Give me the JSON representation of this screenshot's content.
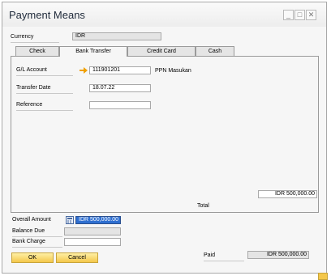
{
  "window": {
    "title": "Payment Means"
  },
  "header": {
    "currency_label": "Currency",
    "currency_value": "IDR"
  },
  "tabs": [
    {
      "label": "Check"
    },
    {
      "label": "Bank Transfer"
    },
    {
      "label": "Credit Card"
    },
    {
      "label": "Cash"
    }
  ],
  "bank_transfer": {
    "gl_account_label": "G/L Account",
    "gl_account_value": "111901201",
    "gl_account_name": "PPN Masukan",
    "transfer_date_label": "Transfer Date",
    "transfer_date_value": "18.07.22",
    "reference_label": "Reference",
    "reference_value": "",
    "total_label": "Total",
    "total_value": "IDR 500,000.00"
  },
  "summary": {
    "overall_amount_label": "Overall Amount",
    "overall_amount_value": "IDR 500,000.00",
    "balance_due_label": "Balance Due",
    "balance_due_value": "",
    "bank_charge_label": "Bank Charge",
    "bank_charge_value": "",
    "paid_label": "Paid",
    "paid_value": "IDR 500,000.00"
  },
  "buttons": {
    "ok": "OK",
    "cancel": "Cancel"
  },
  "colors": {
    "button_gold": "#f4c74a",
    "link_arrow": "#f0a000",
    "selection": "#2f6fd0"
  }
}
